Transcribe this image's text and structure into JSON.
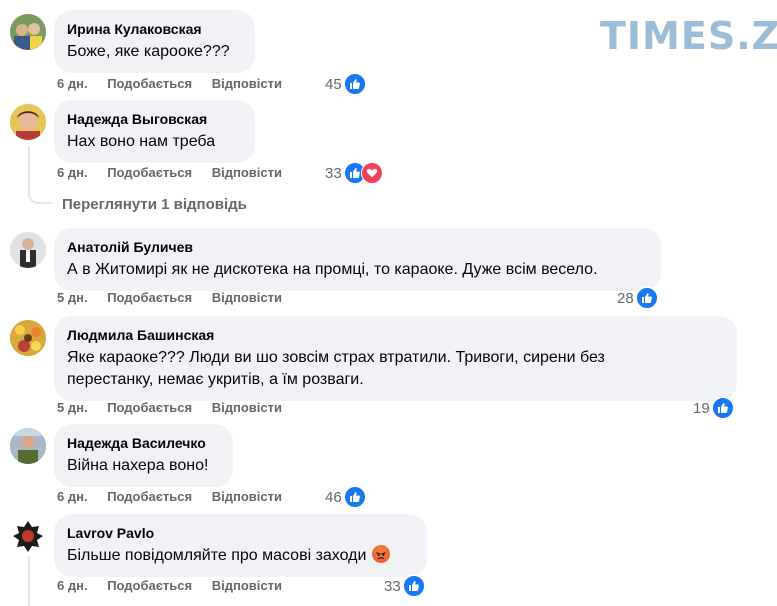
{
  "brand": {
    "logo_text": "TIMES.ZT"
  },
  "actions": {
    "like_label": "Подобається",
    "reply_label": "Відповісти"
  },
  "comments": [
    {
      "author": "Ирина Кулаковская",
      "text": "Боже, яке карооке???",
      "time": "6 дн.",
      "reactions": "45",
      "reaction_types": [
        "like"
      ]
    },
    {
      "author": "Надежда Выговская",
      "text": "Нах воно нам треба",
      "time": "6 дн.",
      "reactions": "33",
      "reaction_types": [
        "like",
        "love"
      ]
    },
    {
      "author": "Анатолій Буличев",
      "text": "А в Житомирі як не дискотека на промці, то караоке. Дуже всім весело.",
      "time": "5 дн.",
      "reactions": "28",
      "reaction_types": [
        "like"
      ]
    },
    {
      "author": "Людмила Башинская",
      "text_line1": "Яке караоке??? Люди ви шо зовсім страх втратили. Тривоги, сирени без",
      "text_line2": "перестанку, немає укритів, а їм розваги.",
      "time": "5 дн.",
      "reactions": "19",
      "reaction_types": [
        "like"
      ]
    },
    {
      "author": "Надежда Василечко",
      "text": "Війна нахера воно!",
      "time": "6 дн.",
      "reactions": "46",
      "reaction_types": [
        "like"
      ]
    },
    {
      "author": "Lavrov Pavlo",
      "text": "Більше повідомляйте про масові заходи",
      "emoji": "angry-face",
      "time": "6 дн.",
      "reactions": "33",
      "reaction_types": [
        "like"
      ]
    }
  ],
  "view_replies": "Переглянути 1 відповідь",
  "colors": {
    "like": "#1877f2",
    "love": "#f33e58",
    "bubble": "#f0f2f5",
    "meta": "#65676b",
    "logo": "#9dbcd6"
  }
}
